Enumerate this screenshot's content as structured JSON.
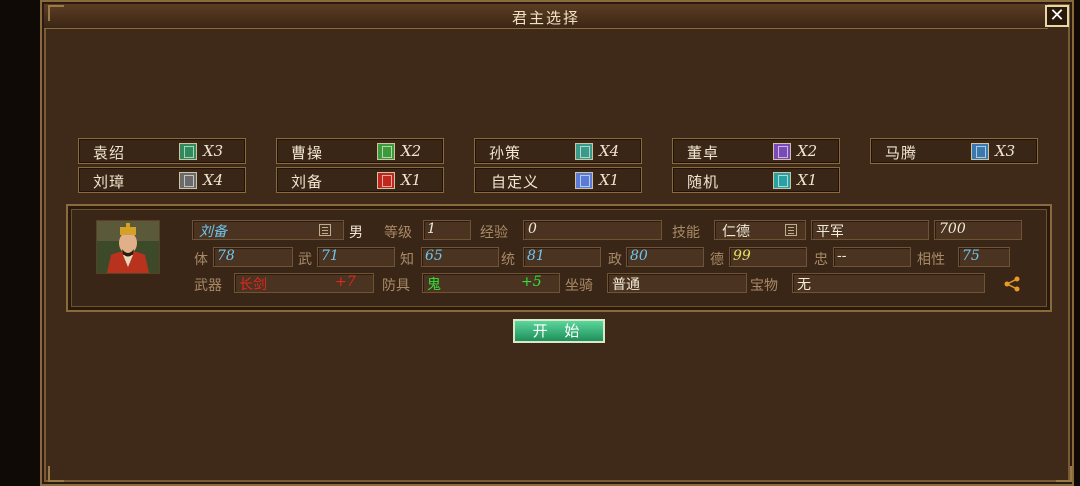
{
  "window": {
    "title": "君主选择",
    "close_label": "✕"
  },
  "lords": [
    {
      "name": "袁绍",
      "count": "X3",
      "flag_color": "#2f8a5c"
    },
    {
      "name": "曹操",
      "count": "X2",
      "flag_color": "#3c9a3a"
    },
    {
      "name": "孙策",
      "count": "X4",
      "flag_color": "#3a9a8a"
    },
    {
      "name": "董卓",
      "count": "X2",
      "flag_color": "#7a4ab8"
    },
    {
      "name": "马腾",
      "count": "X3",
      "flag_color": "#3a78b0"
    },
    {
      "name": "刘璋",
      "count": "X4",
      "flag_color": "#6a6a6a"
    },
    {
      "name": "刘备",
      "count": "X1",
      "flag_color": "#c0281e"
    },
    {
      "name": "自定义",
      "count": "X1",
      "flag_color": "#5a7ad8"
    },
    {
      "name": "随机",
      "count": "X1",
      "flag_color": "#2aa0a0"
    }
  ],
  "general": {
    "name": "刘备",
    "gender": "男",
    "level_label": "等级",
    "level": "1",
    "exp_label": "经验",
    "exp": "0",
    "skill_label": "技能",
    "skill": "仁德",
    "troop": "平军",
    "troop_value": "700",
    "stats": [
      {
        "label": "体",
        "value": "78"
      },
      {
        "label": "武",
        "value": "71"
      },
      {
        "label": "知",
        "value": "65"
      },
      {
        "label": "统",
        "value": "81"
      },
      {
        "label": "政",
        "value": "80"
      },
      {
        "label": "德",
        "value": "99"
      },
      {
        "label": "忠",
        "value": "--"
      },
      {
        "label": "相性",
        "value": "75"
      }
    ],
    "weapon_label": "武器",
    "weapon": "长剑",
    "weapon_bonus": "+7",
    "armor_label": "防具",
    "armor": "鬼",
    "armor_bonus": "+5",
    "mount_label": "坐骑",
    "mount": "普通",
    "treasure_label": "宝物",
    "treasure": "无"
  },
  "start_button": "开 始",
  "colors": {
    "panel_bg": "#3f2a1a",
    "border": "#8a6a3d",
    "stat_value": "#6ec6f0",
    "button": "#2faa6a"
  }
}
